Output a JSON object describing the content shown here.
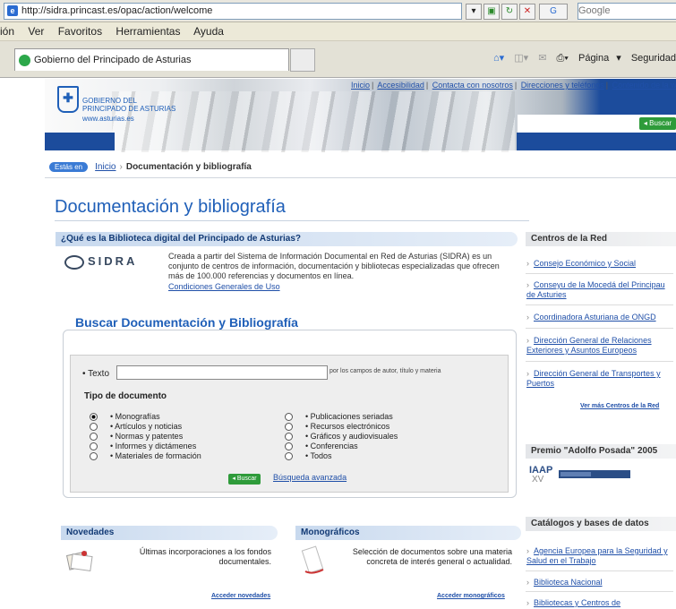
{
  "browser": {
    "url": "http://sidra.princast.es/opac/action/welcome",
    "search_engine": "Google",
    "menu": [
      "ión",
      "Ver",
      "Favoritos",
      "Herramientas",
      "Ayuda"
    ],
    "tab_title": "Gobierno del Principado de Asturias",
    "cmd_items": [
      "Página",
      "Seguridad"
    ]
  },
  "header": {
    "logo_lines": [
      "GOBIERNO DEL",
      "PRINCIPADO DE ASTURIAS"
    ],
    "logo_url": "www.asturias.es",
    "links": [
      "Inicio",
      "Accesibilidad",
      "Contacta con nosotros",
      "Direcciones y teléfonos",
      "Contenido de la we"
    ],
    "search_button": "Buscar"
  },
  "breadcrumb": {
    "badge": "Estás en",
    "home": "Inicio",
    "current": "Documentación y bibliografía"
  },
  "page_title": "Documentación y bibliografía",
  "about": {
    "heading": "¿Qué es la Biblioteca digital del Principado de Asturias?",
    "logo": "SIDRA",
    "description": "Creada a partir del Sistema de Información Documental en Red de Asturias (SIDRA) es un conjunto de centros de información, documentación y bibliotecas especializadas que ofrecen más de 100.000 referencias y documentos en línea.",
    "conditions_link": "Condiciones Generales de Uso"
  },
  "search": {
    "heading": "Buscar Documentación y Bibliografía",
    "texto_label": "Texto",
    "texto_value": "",
    "texto_hint": "por los campos de autor, título y materia",
    "tipo_label": "Tipo de documento",
    "options_left": [
      "Monografías",
      "Artículos y noticias",
      "Normas y patentes",
      "Informes y dictámenes",
      "Materiales de formación"
    ],
    "options_right": [
      "Publicaciones seriadas",
      "Recursos electrónicos",
      "Gráficos y audiovisuales",
      "Conferencias",
      "Todos"
    ],
    "selected": "Monografías",
    "submit": "Buscar",
    "advanced": "Búsqueda avanzada"
  },
  "novedades": {
    "heading": "Novedades",
    "text": "Últimas incorporaciones a los fondos documentales.",
    "link": "Acceder novedades"
  },
  "monograficos": {
    "heading": "Monográficos",
    "text": "Selección de documentos sobre una materia concreta de interés general o actualidad.",
    "link": "Acceder monográficos"
  },
  "sidebar": {
    "centros_heading": "Centros de la Red",
    "centros": [
      "Consejo Económico y Social",
      "Conseyu de la Mocedá del Principau de Asturies",
      "Coordinadora Asturiana de ONGD",
      "Dirección General de Relaciones Exteriores y Asuntos Europeos",
      "Dirección General de Transportes y Puertos"
    ],
    "ver_mas": "Ver más Centros de la Red",
    "premio_heading": "Premio \"Adolfo Posada\" 2005",
    "premio_logo": "IAAP",
    "catalogos_heading": "Catálogos y bases de datos",
    "catalogos": [
      "Agencia Europea para la Seguridad y Salud en el Trabajo",
      "Biblioteca Nacional",
      "Bibliotecas y Centros de"
    ]
  },
  "colors": {
    "brand_blue": "#1f5fb8",
    "header_blue": "#1c4c9c",
    "button_green": "#2e9b3a",
    "link_blue": "#1f4fa8"
  }
}
